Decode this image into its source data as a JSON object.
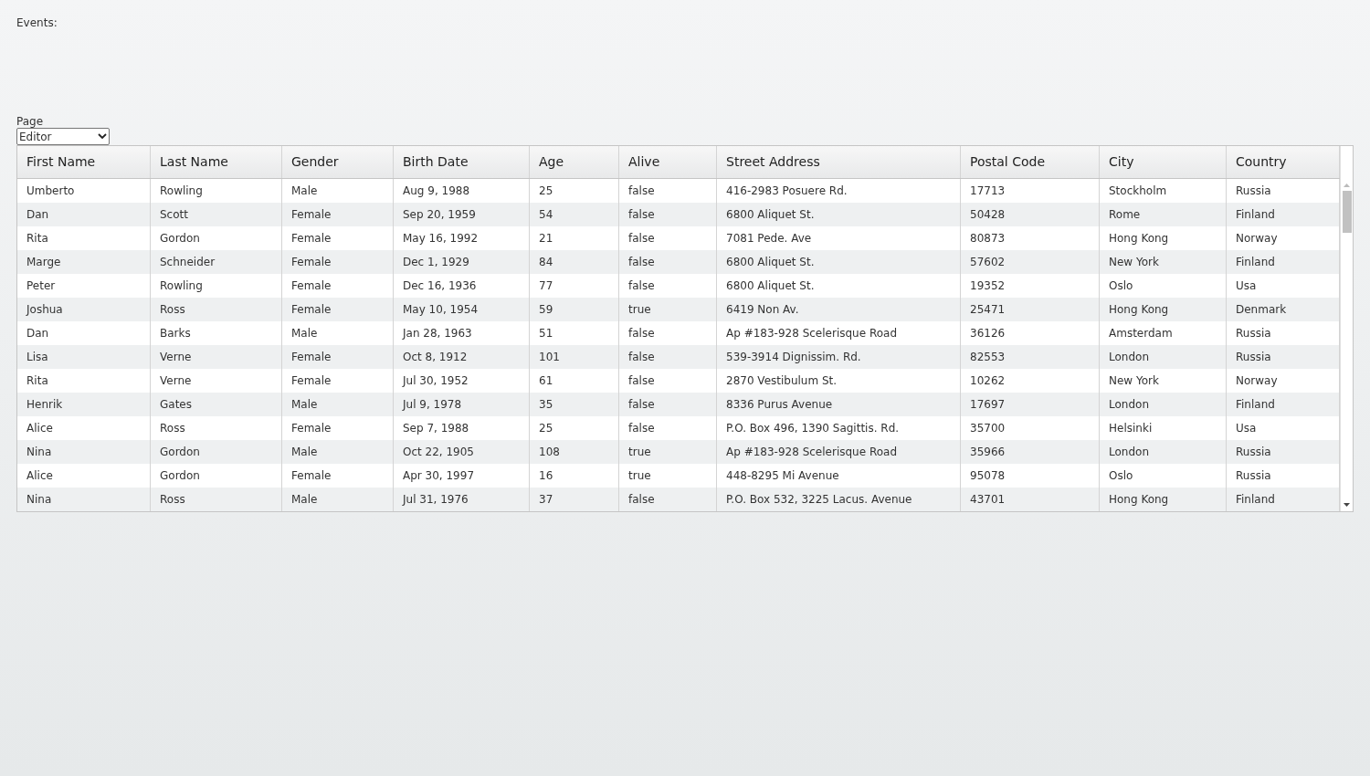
{
  "events_label": "Events:",
  "page_select": {
    "label": "Page",
    "value": "Editor"
  },
  "table": {
    "columns": [
      "First Name",
      "Last Name",
      "Gender",
      "Birth Date",
      "Age",
      "Alive",
      "Street Address",
      "Postal Code",
      "City",
      "Country"
    ],
    "rows": [
      [
        "Umberto",
        "Rowling",
        "Male",
        "Aug 9, 1988",
        "25",
        "false",
        "416-2983 Posuere Rd.",
        "17713",
        "Stockholm",
        "Russia"
      ],
      [
        "Dan",
        "Scott",
        "Female",
        "Sep 20, 1959",
        "54",
        "false",
        "6800 Aliquet St.",
        "50428",
        "Rome",
        "Finland"
      ],
      [
        "Rita",
        "Gordon",
        "Female",
        "May 16, 1992",
        "21",
        "false",
        "7081 Pede. Ave",
        "80873",
        "Hong Kong",
        "Norway"
      ],
      [
        "Marge",
        "Schneider",
        "Female",
        "Dec 1, 1929",
        "84",
        "false",
        "6800 Aliquet St.",
        "57602",
        "New York",
        "Finland"
      ],
      [
        "Peter",
        "Rowling",
        "Female",
        "Dec 16, 1936",
        "77",
        "false",
        "6800 Aliquet St.",
        "19352",
        "Oslo",
        "Usa"
      ],
      [
        "Joshua",
        "Ross",
        "Female",
        "May 10, 1954",
        "59",
        "true",
        "6419 Non Av.",
        "25471",
        "Hong Kong",
        "Denmark"
      ],
      [
        "Dan",
        "Barks",
        "Male",
        "Jan 28, 1963",
        "51",
        "false",
        "Ap #183-928 Scelerisque Road",
        "36126",
        "Amsterdam",
        "Russia"
      ],
      [
        "Lisa",
        "Verne",
        "Female",
        "Oct 8, 1912",
        "101",
        "false",
        "539-3914 Dignissim. Rd.",
        "82553",
        "London",
        "Russia"
      ],
      [
        "Rita",
        "Verne",
        "Female",
        "Jul 30, 1952",
        "61",
        "false",
        "2870 Vestibulum St.",
        "10262",
        "New York",
        "Norway"
      ],
      [
        "Henrik",
        "Gates",
        "Male",
        "Jul 9, 1978",
        "35",
        "false",
        "8336 Purus Avenue",
        "17697",
        "London",
        "Finland"
      ],
      [
        "Alice",
        "Ross",
        "Female",
        "Sep 7, 1988",
        "25",
        "false",
        "P.O. Box 496, 1390 Sagittis. Rd.",
        "35700",
        "Helsinki",
        "Usa"
      ],
      [
        "Nina",
        "Gordon",
        "Male",
        "Oct 22, 1905",
        "108",
        "true",
        "Ap #183-928 Scelerisque Road",
        "35966",
        "London",
        "Russia"
      ],
      [
        "Alice",
        "Gordon",
        "Female",
        "Apr 30, 1997",
        "16",
        "true",
        "448-8295 Mi Avenue",
        "95078",
        "Oslo",
        "Russia"
      ],
      [
        "Nina",
        "Ross",
        "Male",
        "Jul 31, 1976",
        "37",
        "false",
        "P.O. Box 532, 3225 Lacus. Avenue",
        "43701",
        "Hong Kong",
        "Finland"
      ]
    ]
  }
}
